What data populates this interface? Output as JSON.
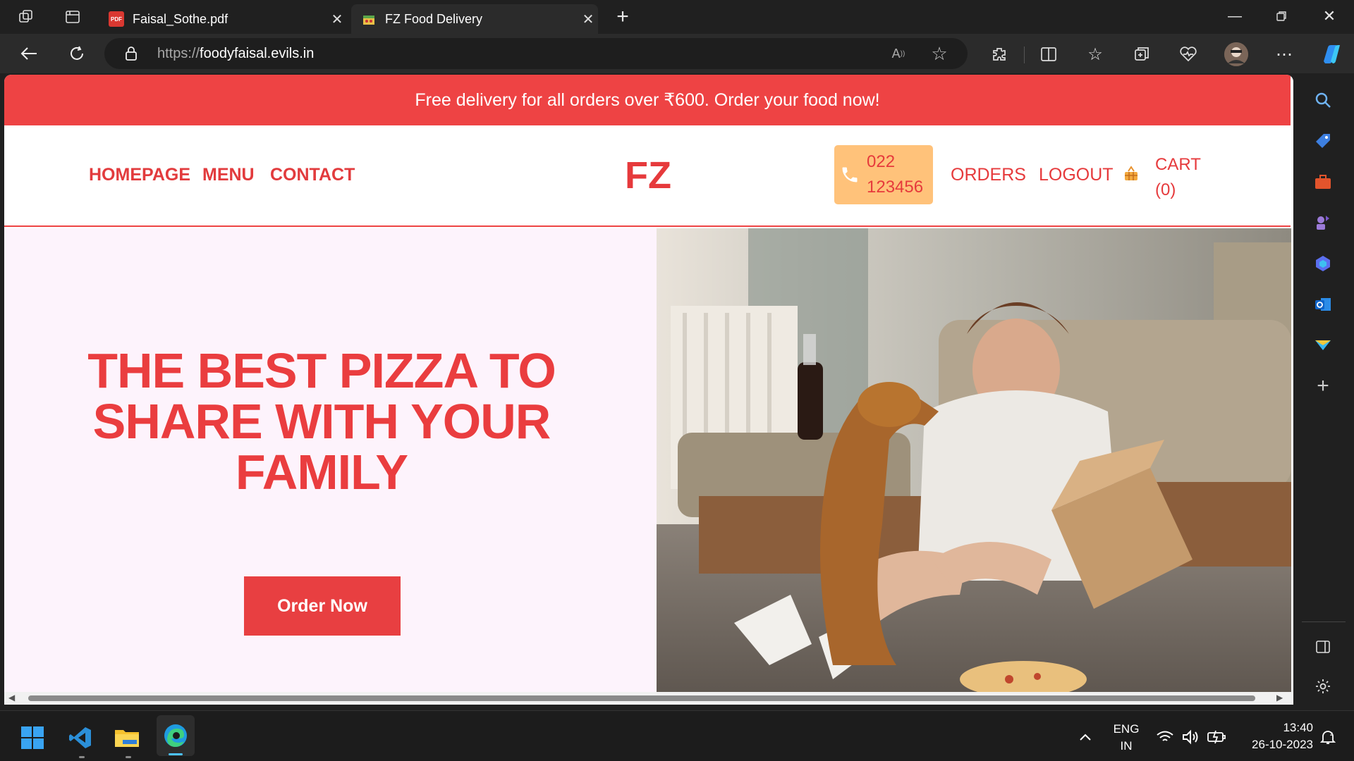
{
  "browser": {
    "tabs": [
      {
        "label": "Faisal_Sothe.pdf",
        "icon": "pdf-icon"
      },
      {
        "label": "FZ Food Delivery",
        "icon": "site-favicon"
      }
    ],
    "url_protocol": "https://",
    "url_domain": "foodyfaisal.evils.in"
  },
  "site": {
    "banner": "Free delivery for all orders over ₹600. Order your food now!",
    "nav": {
      "home": "HOMEPAGE",
      "menu": "MENU",
      "contact": "CONTACT"
    },
    "logo": "FZ",
    "phone_line1": "022",
    "phone_line2": "123456",
    "orders": "ORDERS",
    "logout": "LOGOUT",
    "cart_line1": "CART",
    "cart_line2": "(0)",
    "headline_1": "THE BEST PIZZA TO",
    "headline_2": "SHARE WITH YOUR",
    "headline_3": "FAMILY",
    "cta": "Order Now"
  },
  "taskbar": {
    "lang_1": "ENG",
    "lang_2": "IN",
    "time": "13:40",
    "date": "26-10-2023"
  },
  "colors": {
    "brand": "#ee4344",
    "phone_bg": "#ffc27a",
    "hero_bg": "#fdf3fc"
  }
}
